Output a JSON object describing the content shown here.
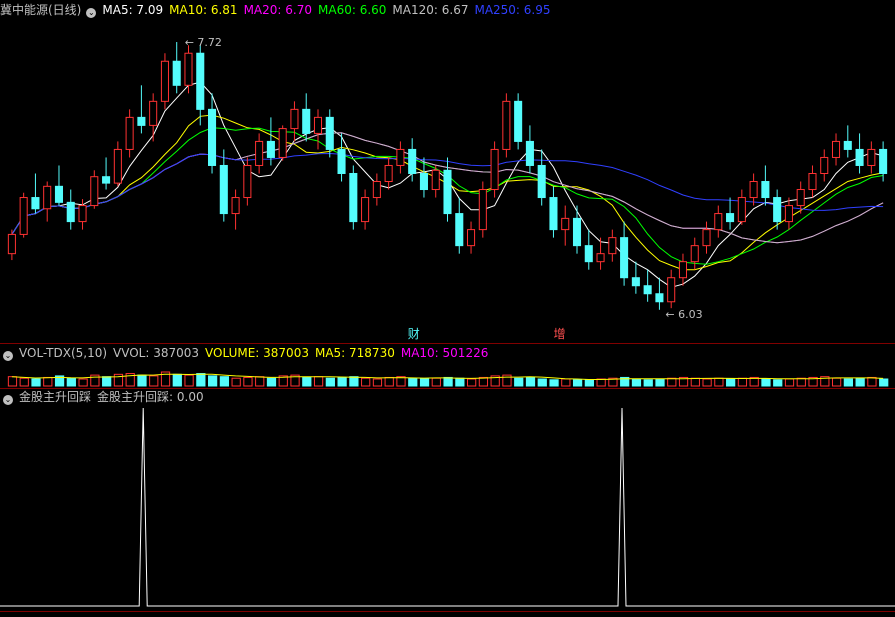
{
  "stock": {
    "title": "冀中能源(日线)",
    "ma_labels": [
      {
        "text": "MA5: 7.09",
        "color": "#ffffff"
      },
      {
        "text": "MA10: 6.81",
        "color": "#ffff00"
      },
      {
        "text": "MA20: 6.70",
        "color": "#ff00ff"
      },
      {
        "text": "MA60: 6.60",
        "color": "#00ff00"
      },
      {
        "text": "MA120: 6.67",
        "color": "#c0c0c0"
      },
      {
        "text": "MA250: 6.95",
        "color": "#3040ff"
      }
    ],
    "high_label": "7.72",
    "low_label": "6.03",
    "event_labels": [
      "财",
      "增"
    ]
  },
  "volume": {
    "title": "VOL-TDX(5,10)",
    "labels": [
      {
        "text": "VVOL: 387003",
        "color": "#c0c0c0"
      },
      {
        "text": "VOLUME: 387003",
        "color": "#ffff00"
      },
      {
        "text": "MA5: 718730",
        "color": "#ffff00"
      },
      {
        "text": "MA10: 501226",
        "color": "#ff00ff"
      }
    ]
  },
  "indicator": {
    "title": "金股主升回踩",
    "label": "金股主升回踩: 0.00"
  },
  "colors": {
    "up": "#ff3232",
    "down": "#54fcfc",
    "grid": "#800000"
  },
  "chart_data": {
    "type": "candlestick",
    "price_high": 7.72,
    "price_low": 6.03,
    "candles": [
      [
        6.4,
        6.55,
        6.36,
        6.52
      ],
      [
        6.52,
        6.78,
        6.5,
        6.75
      ],
      [
        6.75,
        6.9,
        6.65,
        6.68
      ],
      [
        6.68,
        6.85,
        6.6,
        6.82
      ],
      [
        6.82,
        6.95,
        6.7,
        6.72
      ],
      [
        6.72,
        6.8,
        6.55,
        6.6
      ],
      [
        6.6,
        6.74,
        6.55,
        6.7
      ],
      [
        6.7,
        6.92,
        6.68,
        6.88
      ],
      [
        6.88,
        7.0,
        6.8,
        6.84
      ],
      [
        6.84,
        7.1,
        6.82,
        7.05
      ],
      [
        7.05,
        7.3,
        7.0,
        7.25
      ],
      [
        7.25,
        7.45,
        7.15,
        7.2
      ],
      [
        7.2,
        7.4,
        7.1,
        7.35
      ],
      [
        7.35,
        7.65,
        7.3,
        7.6
      ],
      [
        7.6,
        7.72,
        7.4,
        7.45
      ],
      [
        7.45,
        7.7,
        7.4,
        7.65
      ],
      [
        7.65,
        7.7,
        7.2,
        7.3
      ],
      [
        7.3,
        7.4,
        6.9,
        6.95
      ],
      [
        6.95,
        7.05,
        6.6,
        6.65
      ],
      [
        6.65,
        6.8,
        6.55,
        6.75
      ],
      [
        6.75,
        7.0,
        6.7,
        6.95
      ],
      [
        6.95,
        7.15,
        6.9,
        7.1
      ],
      [
        7.1,
        7.25,
        6.95,
        7.0
      ],
      [
        7.0,
        7.2,
        6.98,
        7.18
      ],
      [
        7.18,
        7.35,
        7.1,
        7.3
      ],
      [
        7.3,
        7.4,
        7.1,
        7.15
      ],
      [
        7.15,
        7.3,
        7.05,
        7.25
      ],
      [
        7.25,
        7.3,
        7.0,
        7.05
      ],
      [
        7.05,
        7.15,
        6.85,
        6.9
      ],
      [
        6.9,
        6.95,
        6.55,
        6.6
      ],
      [
        6.6,
        6.8,
        6.55,
        6.75
      ],
      [
        6.75,
        6.9,
        6.7,
        6.85
      ],
      [
        6.85,
        7.0,
        6.8,
        6.95
      ],
      [
        6.95,
        7.1,
        6.9,
        7.05
      ],
      [
        7.05,
        7.12,
        6.85,
        6.9
      ],
      [
        6.9,
        7.0,
        6.75,
        6.8
      ],
      [
        6.8,
        6.95,
        6.75,
        6.92
      ],
      [
        6.92,
        7.0,
        6.6,
        6.65
      ],
      [
        6.65,
        6.75,
        6.4,
        6.45
      ],
      [
        6.45,
        6.6,
        6.4,
        6.55
      ],
      [
        6.55,
        6.85,
        6.5,
        6.8
      ],
      [
        6.8,
        7.1,
        6.75,
        7.05
      ],
      [
        7.05,
        7.4,
        7.0,
        7.35
      ],
      [
        7.35,
        7.4,
        7.05,
        7.1
      ],
      [
        7.1,
        7.2,
        6.9,
        6.95
      ],
      [
        6.95,
        7.05,
        6.7,
        6.75
      ],
      [
        6.75,
        6.82,
        6.5,
        6.55
      ],
      [
        6.55,
        6.7,
        6.45,
        6.62
      ],
      [
        6.62,
        6.7,
        6.4,
        6.45
      ],
      [
        6.45,
        6.55,
        6.3,
        6.35
      ],
      [
        6.35,
        6.5,
        6.3,
        6.4
      ],
      [
        6.4,
        6.55,
        6.35,
        6.5
      ],
      [
        6.5,
        6.6,
        6.2,
        6.25
      ],
      [
        6.25,
        6.35,
        6.15,
        6.2
      ],
      [
        6.2,
        6.3,
        6.1,
        6.15
      ],
      [
        6.15,
        6.25,
        6.05,
        6.1
      ],
      [
        6.1,
        6.3,
        6.06,
        6.25
      ],
      [
        6.25,
        6.4,
        6.2,
        6.35
      ],
      [
        6.35,
        6.5,
        6.3,
        6.45
      ],
      [
        6.45,
        6.6,
        6.4,
        6.55
      ],
      [
        6.55,
        6.7,
        6.5,
        6.65
      ],
      [
        6.65,
        6.75,
        6.55,
        6.6
      ],
      [
        6.6,
        6.8,
        6.58,
        6.75
      ],
      [
        6.75,
        6.9,
        6.7,
        6.85
      ],
      [
        6.85,
        6.95,
        6.7,
        6.75
      ],
      [
        6.75,
        6.8,
        6.55,
        6.6
      ],
      [
        6.6,
        6.75,
        6.55,
        6.7
      ],
      [
        6.7,
        6.85,
        6.65,
        6.8
      ],
      [
        6.8,
        6.95,
        6.75,
        6.9
      ],
      [
        6.9,
        7.05,
        6.85,
        7.0
      ],
      [
        7.0,
        7.15,
        6.95,
        7.1
      ],
      [
        7.1,
        7.2,
        7.0,
        7.05
      ],
      [
        7.05,
        7.15,
        6.9,
        6.95
      ],
      [
        6.95,
        7.1,
        6.9,
        7.05
      ],
      [
        7.05,
        7.1,
        6.85,
        6.9
      ]
    ],
    "volume_bars": [
      [
        12,
        1
      ],
      [
        10,
        1
      ],
      [
        9,
        0
      ],
      [
        11,
        1
      ],
      [
        13,
        0
      ],
      [
        10,
        0
      ],
      [
        9,
        1
      ],
      [
        14,
        1
      ],
      [
        12,
        0
      ],
      [
        15,
        1
      ],
      [
        16,
        1
      ],
      [
        14,
        0
      ],
      [
        13,
        1
      ],
      [
        18,
        1
      ],
      [
        15,
        0
      ],
      [
        14,
        1
      ],
      [
        16,
        0
      ],
      [
        13,
        0
      ],
      [
        12,
        0
      ],
      [
        10,
        1
      ],
      [
        11,
        1
      ],
      [
        12,
        1
      ],
      [
        10,
        0
      ],
      [
        13,
        1
      ],
      [
        14,
        1
      ],
      [
        11,
        0
      ],
      [
        12,
        1
      ],
      [
        10,
        0
      ],
      [
        11,
        0
      ],
      [
        12,
        0
      ],
      [
        10,
        1
      ],
      [
        9,
        1
      ],
      [
        11,
        1
      ],
      [
        12,
        1
      ],
      [
        10,
        0
      ],
      [
        9,
        0
      ],
      [
        10,
        1
      ],
      [
        11,
        0
      ],
      [
        10,
        0
      ],
      [
        9,
        1
      ],
      [
        11,
        1
      ],
      [
        13,
        1
      ],
      [
        14,
        1
      ],
      [
        10,
        0
      ],
      [
        11,
        0
      ],
      [
        9,
        0
      ],
      [
        8,
        0
      ],
      [
        9,
        1
      ],
      [
        8,
        0
      ],
      [
        8,
        0
      ],
      [
        9,
        1
      ],
      [
        10,
        1
      ],
      [
        11,
        0
      ],
      [
        9,
        0
      ],
      [
        8,
        0
      ],
      [
        9,
        0
      ],
      [
        10,
        1
      ],
      [
        11,
        1
      ],
      [
        10,
        1
      ],
      [
        9,
        1
      ],
      [
        10,
        1
      ],
      [
        9,
        0
      ],
      [
        10,
        1
      ],
      [
        11,
        1
      ],
      [
        9,
        0
      ],
      [
        8,
        0
      ],
      [
        9,
        1
      ],
      [
        10,
        1
      ],
      [
        11,
        1
      ],
      [
        12,
        1
      ],
      [
        10,
        1
      ],
      [
        9,
        0
      ],
      [
        10,
        0
      ],
      [
        11,
        1
      ],
      [
        9,
        0
      ]
    ],
    "indicator_spikes_at": [
      0.16,
      0.695
    ],
    "indicator_range": [
      0,
      1
    ]
  }
}
